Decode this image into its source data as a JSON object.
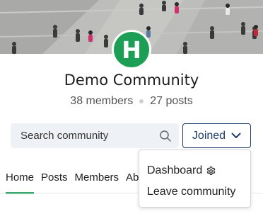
{
  "community": {
    "name": "Demo Community",
    "logo_letter": "H",
    "members": "38 members",
    "posts": "27 posts"
  },
  "search": {
    "placeholder": "Search community",
    "icon": "search-icon"
  },
  "membership_button": {
    "label": "Joined",
    "icon": "chevron-down-icon"
  },
  "tabs": [
    {
      "label": "Home",
      "active": true
    },
    {
      "label": "Posts",
      "active": false
    },
    {
      "label": "Members",
      "active": false
    },
    {
      "label": "About",
      "active": false
    }
  ],
  "dropdown_menu": {
    "items": [
      {
        "label": "Dashboard",
        "icon": "gear-icon"
      },
      {
        "label": "Leave community"
      }
    ]
  },
  "colors": {
    "brand": "#1d9e55",
    "button_border": "#1f3d6b",
    "search_bg": "#eef1f6"
  }
}
